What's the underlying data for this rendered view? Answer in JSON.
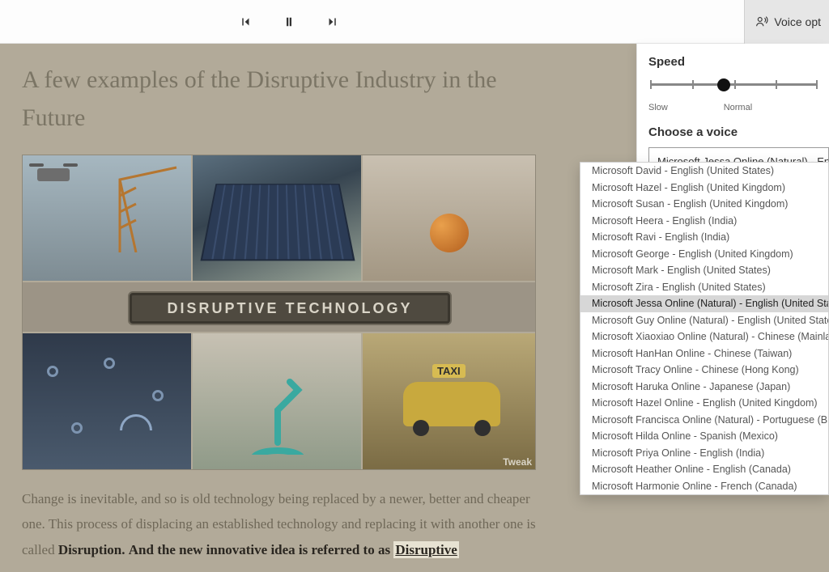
{
  "toolbar": {
    "voice_options_label": "Voice opt"
  },
  "article": {
    "heading": "A few examples of the Disruptive Industry in the Future",
    "banner_text": "DISRUPTIVE TECHNOLOGY",
    "taxi_sign": "TAXI",
    "watermark": "Tweak",
    "paragraph_pre": "Change is inevitable, and so is old technology being replaced by a newer, better and cheaper one. This process of displacing an established technology and replacing it with another one is called ",
    "word_disruption": "Disruption.",
    "paragraph_mid": " And the new innovative idea is referred to as ",
    "word_disruptive": "Disruptive"
  },
  "voice_panel": {
    "speed_label": "Speed",
    "slow_label": "Slow",
    "normal_label": "Normal",
    "speed_position_percent": 44,
    "choose_label": "Choose a voice",
    "selected_voice_display": "Microsoft Jessa Online (Natural) - Engl"
  },
  "voices": [
    {
      "label": "Microsoft David - English (United States)",
      "selected": false
    },
    {
      "label": "Microsoft Hazel - English (United Kingdom)",
      "selected": false
    },
    {
      "label": "Microsoft Susan - English (United Kingdom)",
      "selected": false
    },
    {
      "label": "Microsoft Heera - English (India)",
      "selected": false
    },
    {
      "label": "Microsoft Ravi - English (India)",
      "selected": false
    },
    {
      "label": "Microsoft George - English (United Kingdom)",
      "selected": false
    },
    {
      "label": "Microsoft Mark - English (United States)",
      "selected": false
    },
    {
      "label": "Microsoft Zira - English (United States)",
      "selected": false
    },
    {
      "label": "Microsoft Jessa Online (Natural) - English (United States)",
      "selected": true
    },
    {
      "label": "Microsoft Guy Online (Natural) - English (United States)",
      "selected": false
    },
    {
      "label": "Microsoft Xiaoxiao Online (Natural) - Chinese (Mainland)",
      "selected": false
    },
    {
      "label": "Microsoft HanHan Online - Chinese (Taiwan)",
      "selected": false
    },
    {
      "label": "Microsoft Tracy Online - Chinese (Hong Kong)",
      "selected": false
    },
    {
      "label": "Microsoft Haruka Online - Japanese (Japan)",
      "selected": false
    },
    {
      "label": "Microsoft Hazel Online - English (United Kingdom)",
      "selected": false
    },
    {
      "label": "Microsoft Francisca Online (Natural) - Portuguese (Brazil)",
      "selected": false
    },
    {
      "label": "Microsoft Hilda Online - Spanish (Mexico)",
      "selected": false
    },
    {
      "label": "Microsoft Priya Online - English (India)",
      "selected": false
    },
    {
      "label": "Microsoft Heather Online - English (Canada)",
      "selected": false
    },
    {
      "label": "Microsoft Harmonie Online - French (Canada)",
      "selected": false
    }
  ]
}
